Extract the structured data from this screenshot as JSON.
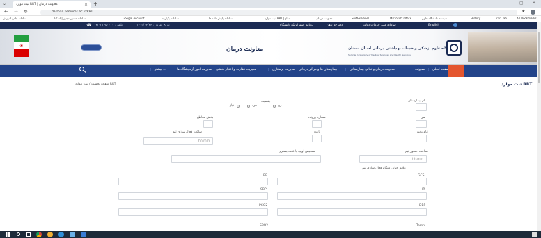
{
  "browser": {
    "tab_title": "ثبت موارد RRT | معاونت درمان",
    "url": "darman.semums.ac.ir/RRT",
    "bookmarks": [
      "سامانه جامع آموزش",
      "سامانه صدور مجوز | اسکتا",
      "Google Account",
      "سامانه یکپارچه ...",
      "سامانه پایش داده ها ...",
      "ثبت موارد RRT | معاو...",
      "معاونت درمان",
      "SurfEx Panel",
      "Microsoft Office",
      "سیستم دانشگاه علوم ...",
      "History",
      "Iran Tab",
      "All Bookmarks"
    ]
  },
  "topbar": {
    "phone": "۰۲۳-۳۱۴۵۰۰۰۰ : تلفن",
    "date": "تاریخ امروز : ۱۴۰۳/۰۴/۲۴",
    "links": [
      "برنامه استراتژیک دانشگاه",
      "دفترچه تلفن",
      "سامانه ملی خدمات دولت",
      "English"
    ]
  },
  "banner": {
    "university_name": "دانشگاه علوم پزشکی و خدمات بهداشتی درمانی استان سمنان",
    "university_name_en": "Semnan University of Medical Sciences and Health Services",
    "title": "معاونت درمان",
    "accent": "#23448a"
  },
  "nav": {
    "items": [
      "صفحه اصلی",
      "معاونت",
      "مدیریت درمان و تعالی بیمارستانی",
      "بیمارستان ها و مراکز درمانی",
      "مدیریت پرستاری",
      "مدیریت نظارت و اعتبار بخشی",
      "مدیریت امور آزمایشگاه ها",
      "بیشتر ..."
    ],
    "search_icon": "search-icon"
  },
  "page": {
    "title": "ثبت موارد RRT",
    "breadcrumb": "صفحه نخست / ثبت موارد RRT"
  },
  "form": {
    "hospital_label": "نام بیمارستان",
    "gender_label": "جنسیت",
    "gender_options": [
      "زن",
      "مرد",
      "نیاز"
    ],
    "age_label": "سن",
    "file_number_label": "شماره پرونده",
    "ward_label": "بخش مقاطع",
    "admit_label": "نام بخش",
    "date_label": "تاریخ",
    "activation_time_label": "ساعت فعال سازی تیم",
    "activation_time_placeholder": "hh:mm",
    "reach_time_label": "ساعت حضور تیم",
    "reach_time_placeholder": "hh:mm",
    "diagnosis_label": "تشخیص اولیه یا علت بستری",
    "vital_signs_title": "علائم حیاتی هنگام فعال سازی تیم",
    "vitals": [
      "GCS",
      "RR",
      "HR",
      "SBP",
      "DBP",
      "PCO2",
      "Temp",
      "SPO2"
    ]
  }
}
